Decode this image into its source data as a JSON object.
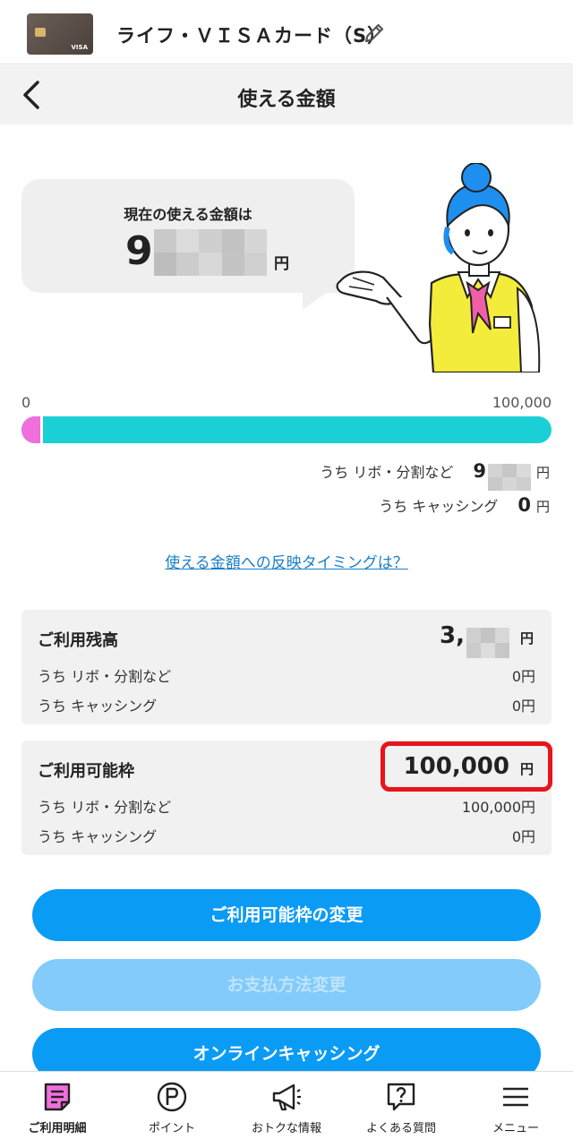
{
  "card": {
    "name": "ライフ・ＶＩＳＡカード（S）",
    "brand_mark": "VISA"
  },
  "page": {
    "title": "使える金額"
  },
  "balance": {
    "label": "現在の使える金額は",
    "amount_visible": "9",
    "yen": "円"
  },
  "meter": {
    "min": "0",
    "max": "100,000",
    "used_fraction": 0.04,
    "colors": {
      "used": "#f06fdc",
      "available": "#1ad0d6"
    }
  },
  "breakdown": {
    "revo_label": "うち リボ・分割など",
    "revo_value_visible": "9",
    "cashing_label": "うち キャッシング",
    "cashing_value": "0",
    "yen": "円"
  },
  "timing_link": "使える金額への反映タイミングは？",
  "usage_balance": {
    "title": "ご利用残高",
    "value_visible": "3,",
    "yen": "円",
    "rows": [
      {
        "label": "うち リボ・分割など",
        "value": "0円"
      },
      {
        "label": "うち キャッシング",
        "value": "0円"
      }
    ]
  },
  "credit_limit": {
    "title": "ご利用可能枠",
    "value": "100,000",
    "yen": "円",
    "rows": [
      {
        "label": "うち リボ・分割など",
        "value": "100,000円"
      },
      {
        "label": "うち キャッシング",
        "value": "0円"
      }
    ]
  },
  "buttons": {
    "change_limit": "ご利用可能枠の変更",
    "payment_change": "お支払方法変更",
    "online_cashing": "オンラインキャッシング"
  },
  "nav": [
    {
      "label": "ご利用明細",
      "icon": "statement-icon",
      "active": true
    },
    {
      "label": "ポイント",
      "icon": "point-icon",
      "active": false
    },
    {
      "label": "おトクな情報",
      "icon": "megaphone-icon",
      "active": false
    },
    {
      "label": "よくある質問",
      "icon": "faq-icon",
      "active": false
    },
    {
      "label": "メニュー",
      "icon": "menu-icon",
      "active": false
    }
  ],
  "colors": {
    "accent": "#0a9bf5",
    "highlight_border": "#e8141b",
    "link": "#1b7fc6"
  }
}
